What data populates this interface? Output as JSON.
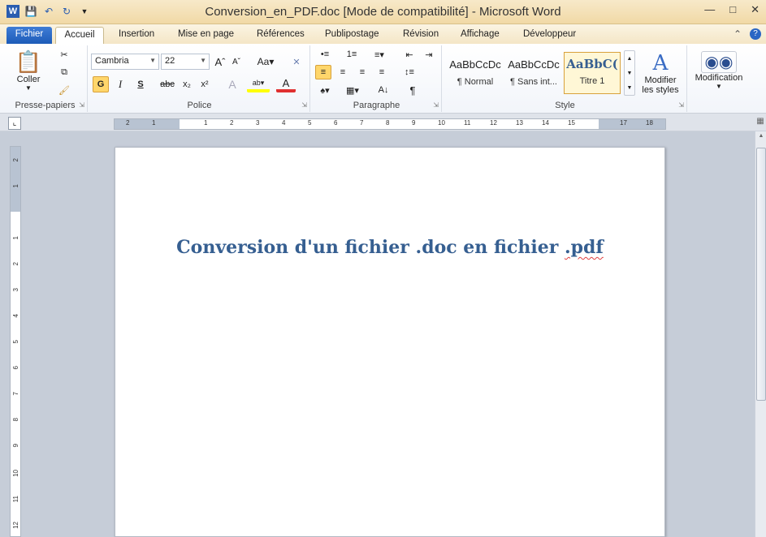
{
  "window": {
    "title": "Conversion_en_PDF.doc [Mode de compatibilité]  -  Microsoft Word",
    "app_icon": "word-icon"
  },
  "tabs": [
    "Fichier",
    "Accueil",
    "Insertion",
    "Mise en page",
    "Références",
    "Publipostage",
    "Révision",
    "Affichage",
    "Développeur"
  ],
  "active_tab": "Accueil",
  "ribbon": {
    "clipboard": {
      "label": "Presse-papiers",
      "paste_label": "Coller"
    },
    "font": {
      "label": "Police",
      "font_name": "Cambria",
      "font_size": "22",
      "bold_label": "G",
      "italic_label": "I",
      "underline_label": "S",
      "strike_label": "abc"
    },
    "paragraph": {
      "label": "Paragraphe"
    },
    "styles": {
      "label": "Style",
      "items": [
        {
          "sample": "AaBbCcDc",
          "name": "¶ Normal"
        },
        {
          "sample": "AaBbCcDc",
          "name": "¶ Sans int..."
        },
        {
          "sample": "AaBbC(",
          "name": "Titre 1"
        }
      ],
      "modify_label_1": "Modifier",
      "modify_label_2": "les styles"
    },
    "editing": {
      "label": "Modification"
    }
  },
  "ruler": {
    "h_numbers": [
      "2",
      "1",
      "1",
      "2",
      "3",
      "4",
      "5",
      "6",
      "7",
      "8",
      "9",
      "10",
      "11",
      "12",
      "13",
      "14",
      "15",
      "17",
      "18"
    ],
    "v_numbers": [
      "2",
      "1",
      "1",
      "2",
      "3",
      "4",
      "5",
      "6",
      "7",
      "8",
      "9",
      "10",
      "11",
      "12"
    ]
  },
  "document": {
    "heading_part1": "Conversion d'un fichier .doc en fichier ",
    "heading_part2": ".pdf",
    "heading_color": "#365f91"
  },
  "colors": {
    "accent_file_tab": "#2a66c4",
    "title_bar": "#f1d9a6"
  }
}
